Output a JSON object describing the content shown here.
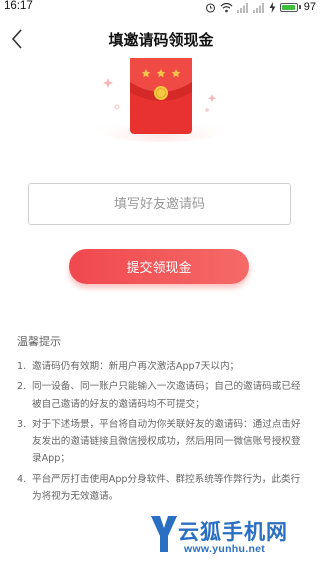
{
  "status_bar": {
    "time": "16:17",
    "battery": "97",
    "battery_level": 0.97,
    "icons": [
      "alarm-icon",
      "wifi-icon",
      "signal-icon",
      "signal-icon",
      "charging-icon",
      "battery-icon"
    ]
  },
  "nav": {
    "back_icon": "chevron-left-icon",
    "title": "填邀请码领现金"
  },
  "illustration": {
    "icon": "red-envelope-icon",
    "colors": {
      "envelope": "#e8322f",
      "star": "#f6c24a",
      "badge": "#f5c842"
    }
  },
  "invite_input": {
    "placeholder": "填写好友邀请码",
    "value": ""
  },
  "submit_button": {
    "label": "提交领现金",
    "color": "#f0484e"
  },
  "tips": {
    "title": "温馨提示",
    "items": [
      {
        "num": "1.",
        "text": "邀请码仍有效期：新用户再次激活App7天以内；"
      },
      {
        "num": "2.",
        "text": "同一设备、同一账户只能输入一次邀请码；自己的邀请码或已经被自己邀请的好友的邀请码均不可提交；"
      },
      {
        "num": "3.",
        "text": "对于下述场景，平台将自动为你关联好友的邀请码：通过点击好友发出的邀请链接且微信授权成功，然后用同一微信账号授权登录App；"
      },
      {
        "num": "4.",
        "text": "平台严厉打击使用App分身软件、群控系统等作弊行为，此类行为将视为无效邀请。"
      }
    ]
  },
  "watermark": {
    "name": "云狐手机网",
    "url": "www.yunhu.net",
    "color": "#2b6fc2"
  }
}
